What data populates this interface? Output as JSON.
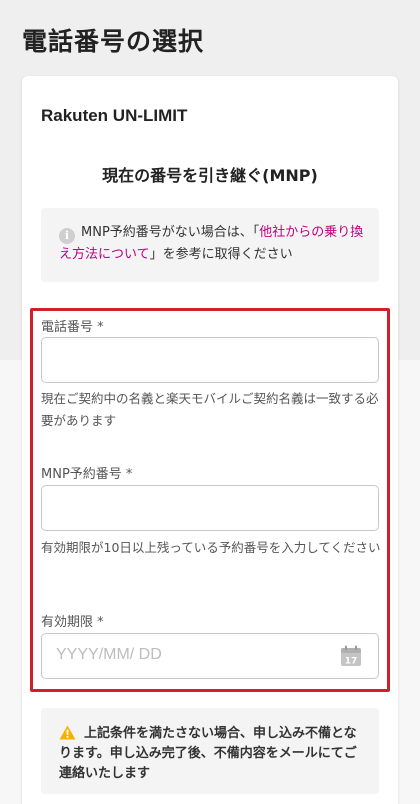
{
  "page": {
    "title": "電話番号の選択"
  },
  "card": {
    "plan_name": "Rakuten UN-LIMIT",
    "section_title": "現在の番号を引き継ぐ(MNP)",
    "info": {
      "icon": "info-icon",
      "text_before": "MNP予約番号がない場合は、「",
      "link": "他社からの乗り換え方法について",
      "text_after": "」を参考に取得ください"
    }
  },
  "form": {
    "phone": {
      "label": "電話番号 *",
      "value": "",
      "helper": "現在ご契約中の名義と楽天モバイルご契約名義は一致する必要があります"
    },
    "mnp": {
      "label": "MNP予約番号 *",
      "value": "",
      "helper": "有効期限が10日以上残っている予約番号を入力してください"
    },
    "expiry": {
      "label": "有効期限 *",
      "placeholder": "YYYY/MM/ DD",
      "calendar_day": "17"
    }
  },
  "warning": {
    "icon": "warning-icon",
    "text": "上記条件を満たさない場合、申し込み不備となります。申し込み完了後、不備内容をメールにてご連絡いたします"
  },
  "colors": {
    "accent_link": "#bf0080",
    "highlight_frame": "#d0202d",
    "warning": "#f5b300"
  }
}
